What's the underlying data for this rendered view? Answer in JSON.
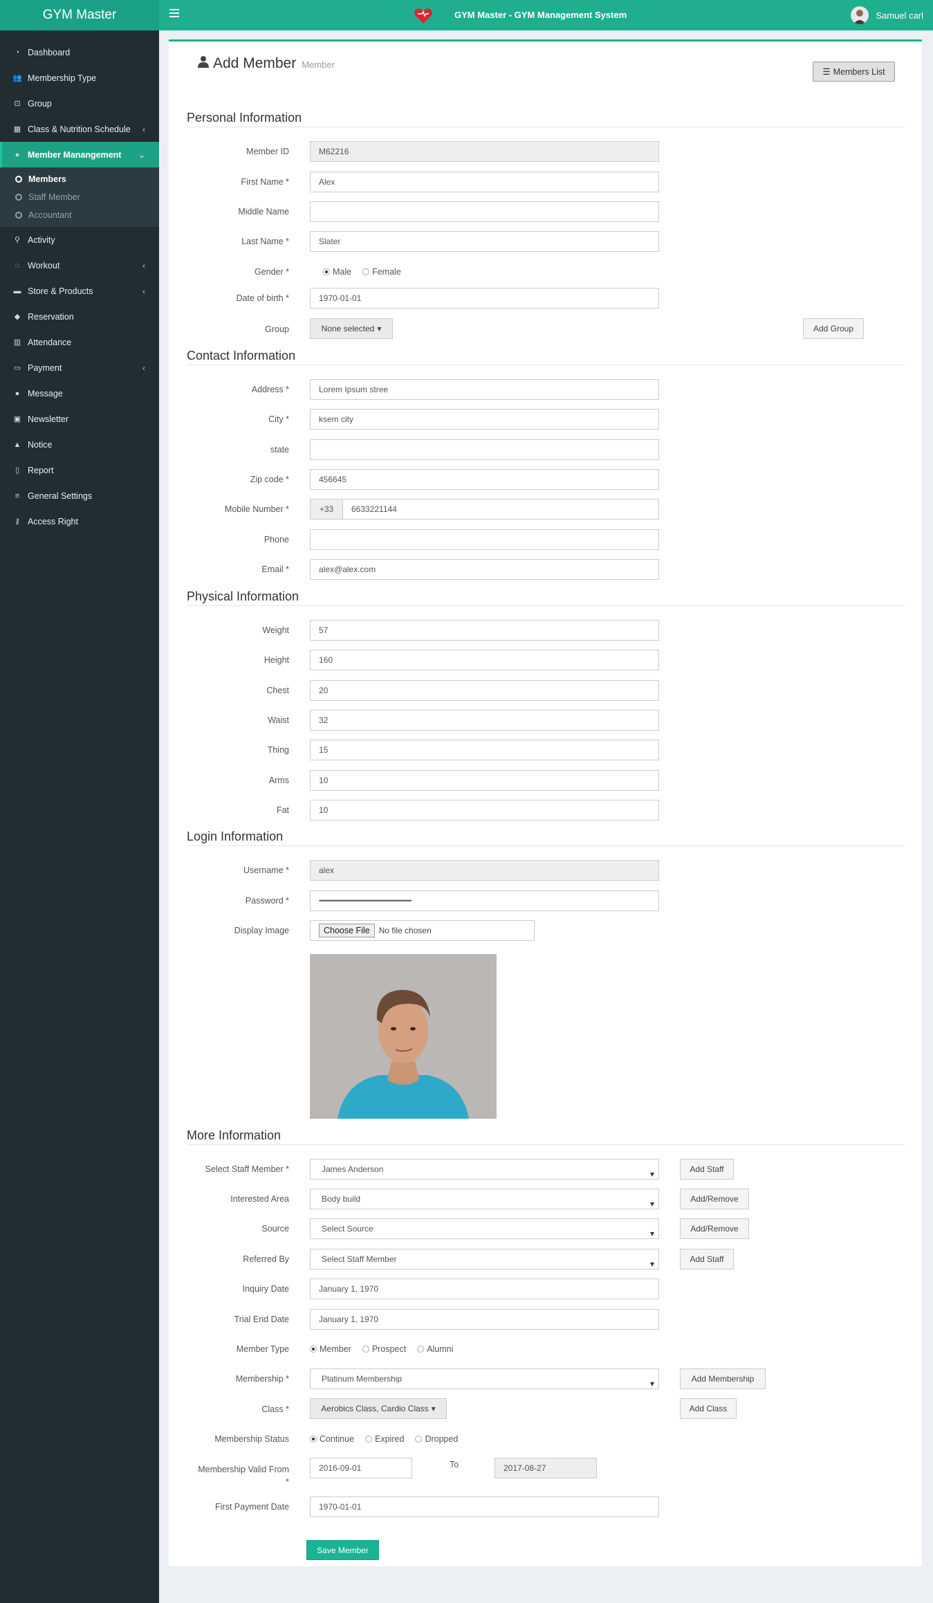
{
  "app": {
    "brand": "GYM Master",
    "title": "GYM Master - GYM Management System",
    "user": "Samuel carl",
    "colors": {
      "primary": "#1fae8e",
      "sidebar": "#222d32"
    }
  },
  "sidebar": {
    "items": [
      {
        "label": "Dashboard",
        "icon": "dashboard-icon"
      },
      {
        "label": "Membership Type",
        "icon": "users-icon"
      },
      {
        "label": "Group",
        "icon": "group-icon"
      },
      {
        "label": "Class & Nutrition Schedule",
        "icon": "calendar-icon"
      },
      {
        "label": "Member Manangement",
        "icon": "user-icon"
      },
      {
        "label": "Activity",
        "icon": "bicycle-icon"
      },
      {
        "label": "Workout",
        "icon": "dumbbell-icon"
      },
      {
        "label": "Store & Products",
        "icon": "truck-icon"
      },
      {
        "label": "Reservation",
        "icon": "tag-icon"
      },
      {
        "label": "Attendance",
        "icon": "barcode-icon"
      },
      {
        "label": "Payment",
        "icon": "money-icon"
      },
      {
        "label": "Message",
        "icon": "comment-icon"
      },
      {
        "label": "Newsletter",
        "icon": "newsletter-icon"
      },
      {
        "label": "Notice",
        "icon": "bell-icon"
      },
      {
        "label": "Report",
        "icon": "file-icon"
      },
      {
        "label": "General Settings",
        "icon": "sliders-icon"
      },
      {
        "label": "Access Right",
        "icon": "key-icon"
      }
    ],
    "subitems": [
      {
        "label": "Members"
      },
      {
        "label": "Staff Member"
      },
      {
        "label": "Accountant"
      }
    ]
  },
  "header": {
    "title": "Add Member",
    "subtitle": "Member",
    "list_button": "Members List"
  },
  "sections": {
    "personal": "Personal Information",
    "contact": "Contact Information",
    "physical": "Physical Information",
    "login": "Login Information",
    "more": "More Information"
  },
  "personal": {
    "member_id": {
      "label": "Member ID",
      "value": "M62216"
    },
    "first_name": {
      "label": "First Name *",
      "value": "Alex"
    },
    "middle_name": {
      "label": "Middle Name",
      "value": ""
    },
    "last_name": {
      "label": "Last Name *",
      "value": "Slater"
    },
    "gender": {
      "label": "Gender *",
      "opt1": "Male",
      "opt2": "Female"
    },
    "dob": {
      "label": "Date of birth *",
      "value": "1970-01-01"
    },
    "group": {
      "label": "Group",
      "value": "None selected",
      "add": "Add Group"
    }
  },
  "contact": {
    "address": {
      "label": "Address *",
      "value": "Lorem Ipsum stree"
    },
    "city": {
      "label": "City *",
      "value": "ksem city"
    },
    "state": {
      "label": "state",
      "value": ""
    },
    "zip": {
      "label": "Zip code *",
      "value": "456645"
    },
    "mobile": {
      "label": "Mobile Number *",
      "prefix": "+33",
      "value": "6633221144"
    },
    "phone": {
      "label": "Phone",
      "value": ""
    },
    "email": {
      "label": "Email *",
      "value": "alex@alex.com"
    }
  },
  "physical": {
    "weight": {
      "label": "Weight",
      "value": "57"
    },
    "height": {
      "label": "Height",
      "value": "160"
    },
    "chest": {
      "label": "Chest",
      "value": "20"
    },
    "waist": {
      "label": "Waist",
      "value": "32"
    },
    "thing": {
      "label": "Thing",
      "value": "15"
    },
    "arms": {
      "label": "Arms",
      "value": "10"
    },
    "fat": {
      "label": "Fat",
      "value": "10"
    }
  },
  "login": {
    "username": {
      "label": "Username *",
      "value": "alex"
    },
    "password": {
      "label": "Password *",
      "value": "••••••••••••••••••••••••••••••••••••••••••••••••••••••••••••••"
    },
    "image": {
      "label": "Display Image",
      "button": "Choose File",
      "status": "No file chosen"
    }
  },
  "more": {
    "staff": {
      "label": "Select Staff Member *",
      "value": "James Anderson",
      "btn": "Add Staff"
    },
    "interest": {
      "label": "Interested Area",
      "value": "Body build",
      "btn": "Add/Remove"
    },
    "source": {
      "label": "Source",
      "value": "Select Source",
      "btn": "Add/Remove"
    },
    "referred": {
      "label": "Referred By",
      "value": "Select Staff Member",
      "btn": "Add Staff"
    },
    "inquiry": {
      "label": "Inquiry Date",
      "value": "January 1, 1970"
    },
    "trial": {
      "label": "Trial End Date",
      "value": "January 1, 1970"
    },
    "mtype": {
      "label": "Member Type",
      "opt1": "Member",
      "opt2": "Prospect",
      "opt3": "Alumni"
    },
    "membership": {
      "label": "Membership *",
      "value": "Platinum Membership",
      "btn": "Add Membership"
    },
    "class": {
      "label": "Class *",
      "value": "Aerobics Class, Cardio Class",
      "btn": "Add Class"
    },
    "status": {
      "label": "Membership Status",
      "opt1": "Continue",
      "opt2": "Expired",
      "opt3": "Dropped"
    },
    "valid": {
      "label": "Membership Valid From",
      "star": "*",
      "from": "2016-09-01",
      "to_label": "To",
      "to": "2017-08-27"
    },
    "first_payment": {
      "label": "First Payment Date",
      "value": "1970-01-01"
    }
  },
  "save": "Save Member"
}
